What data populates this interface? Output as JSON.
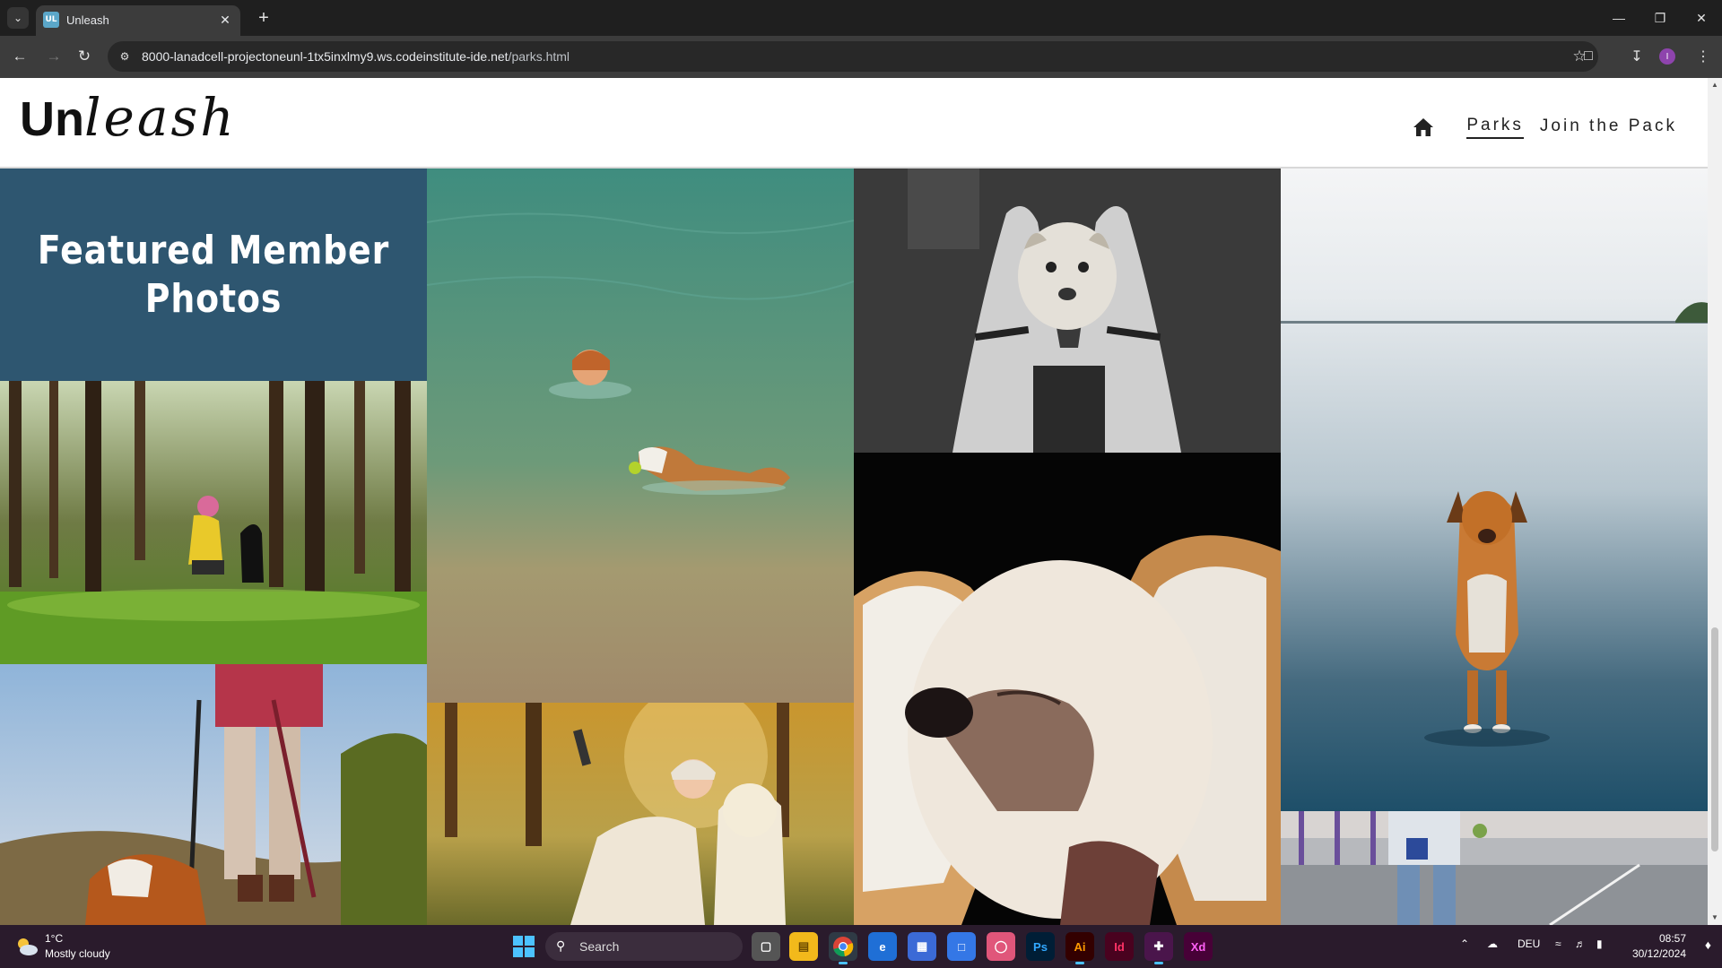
{
  "browser": {
    "tab_title": "Unleash",
    "tab_favicon": "UL",
    "url_host": "8000-lanadcell-projectoneunl-1tx5inxlmy9.ws.codeinstitute-ide.net",
    "url_path": "/parks.html",
    "profile_initial": "I"
  },
  "site": {
    "logo_un": "Un",
    "logo_leash": "leash",
    "nav": {
      "home_icon": "home-icon",
      "parks": "Parks",
      "join": "Join the Pack"
    },
    "featured_title": "Featured Member Photos",
    "colors": {
      "featured_bg": "#2e5670",
      "header_bg": "#ffffff",
      "nav_text": "#222222"
    }
  },
  "taskbar": {
    "weather_temp": "1°C",
    "weather_desc": "Mostly cloudy",
    "search_label": "Search",
    "language": "DEU",
    "time": "08:57",
    "date": "30/12/2024",
    "apps": [
      "Ps",
      "Ai",
      "Id",
      "Xd"
    ]
  }
}
